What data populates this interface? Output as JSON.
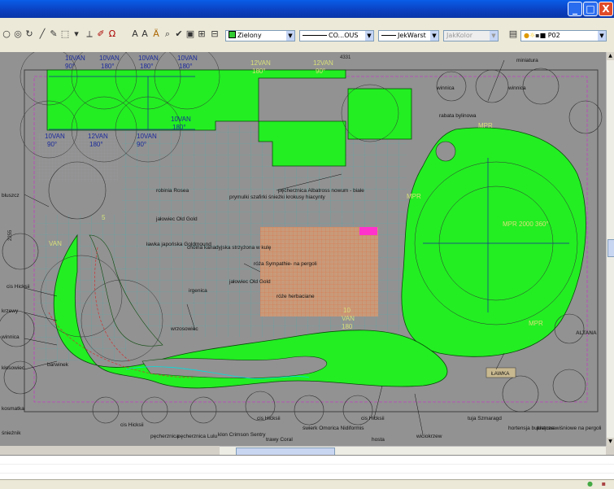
{
  "window": {
    "minimize_label": "_",
    "maximize_label": "□",
    "close_label": "X"
  },
  "toolbar": {
    "color_combo": "Zielony",
    "linetype_combo": "CO...OUS",
    "lineweight_combo": "JekWarst",
    "plotstyle_combo": "JakKolor",
    "layer_combo": "P02"
  },
  "drawing": {
    "dimension_top": "4331",
    "dimension_left": "2255",
    "sprinklers": [
      {
        "name": "10VAN",
        "angle": "90°"
      },
      {
        "name": "10VAN",
        "angle": "180°"
      },
      {
        "name": "10VAN",
        "angle": "180°"
      },
      {
        "name": "10VAN",
        "angle": "180°"
      },
      {
        "name": "10VAN",
        "angle": "90°"
      },
      {
        "name": "12VAN",
        "angle": "180°"
      },
      {
        "name": "10VAN",
        "angle": "90°"
      },
      {
        "name": "10VAN",
        "angle": "180°"
      },
      {
        "name": "12VAN",
        "angle": "180°"
      },
      {
        "name": "12VAN",
        "angle": "90°"
      },
      {
        "name": "5",
        "angle": ""
      },
      {
        "name": "VAN",
        "angle": ""
      },
      {
        "name": "10",
        "angle": ""
      },
      {
        "name": "VAN",
        "angle": "180"
      }
    ],
    "plant_labels": [
      "robinia Rosea",
      "jałowiec Old Gold",
      "ławka japońska Goldmound",
      "choina kanadyjska strzyżona w kulę",
      "pęcherznica Albatross nowum - białe",
      "prymulki szafirki śnieżki krokusy hiacynty",
      "róża Sympathie- na pergoli",
      "jałowiec Old Gold",
      "róże herbaciane",
      "irgenica",
      "wrzosowiec",
      "barwinek",
      "cis Hicksii",
      "pęcherznica",
      "pęcherznica Lulu",
      "klon Crimson Sentry",
      "cis Hicksii",
      "trawy Coral",
      "świerk Omorica Nidiformis",
      "cis Hicksii",
      "hosta",
      "wiciokrzew",
      "tuja Szmaragd",
      "hortensja bukietowa",
      "pnącza wiśniowe na pergoli",
      "rabata bylinowa",
      "winnica",
      "winnica",
      "ALTANA",
      "ŁAWKA",
      "MPR",
      "MPR 2000 360°",
      "MPR",
      "MPR",
      "cis Hicksii",
      "miniatura",
      "krzewy",
      "winnica",
      "bluszcz",
      "kłosowiec",
      "kosmatka",
      "śnieżnik"
    ]
  }
}
